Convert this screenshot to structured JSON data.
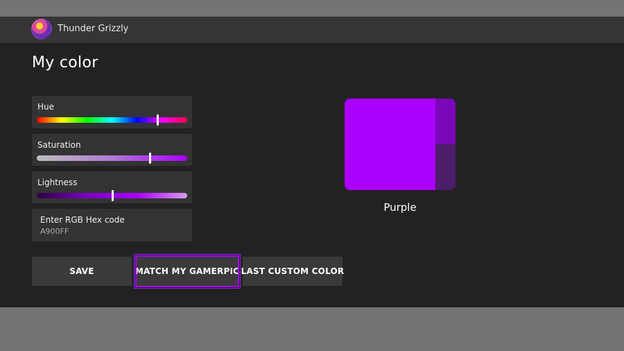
{
  "header": {
    "username": "Thunder Grizzly"
  },
  "page": {
    "title": "My color"
  },
  "sliders": {
    "hue": {
      "label": "Hue",
      "value_fraction": 0.8
    },
    "saturation": {
      "label": "Saturation",
      "value_fraction": 0.75
    },
    "lightness": {
      "label": "Lightness",
      "value_fraction": 0.5
    }
  },
  "hex": {
    "label": "Enter RGB Hex code",
    "value": "A900FF"
  },
  "buttons": {
    "save": "SAVE",
    "match": "MATCH MY GAMERPIC",
    "last": "LAST CUSTOM COLOR"
  },
  "preview": {
    "name": "Purple",
    "colors": {
      "main": "#A900FF",
      "side_top": "#7A08B8",
      "side_bottom": "#4C1D68"
    }
  },
  "colors": {
    "accent": "#A900FF"
  },
  "icons": {
    "avatar": "gamerpic-avatar"
  }
}
